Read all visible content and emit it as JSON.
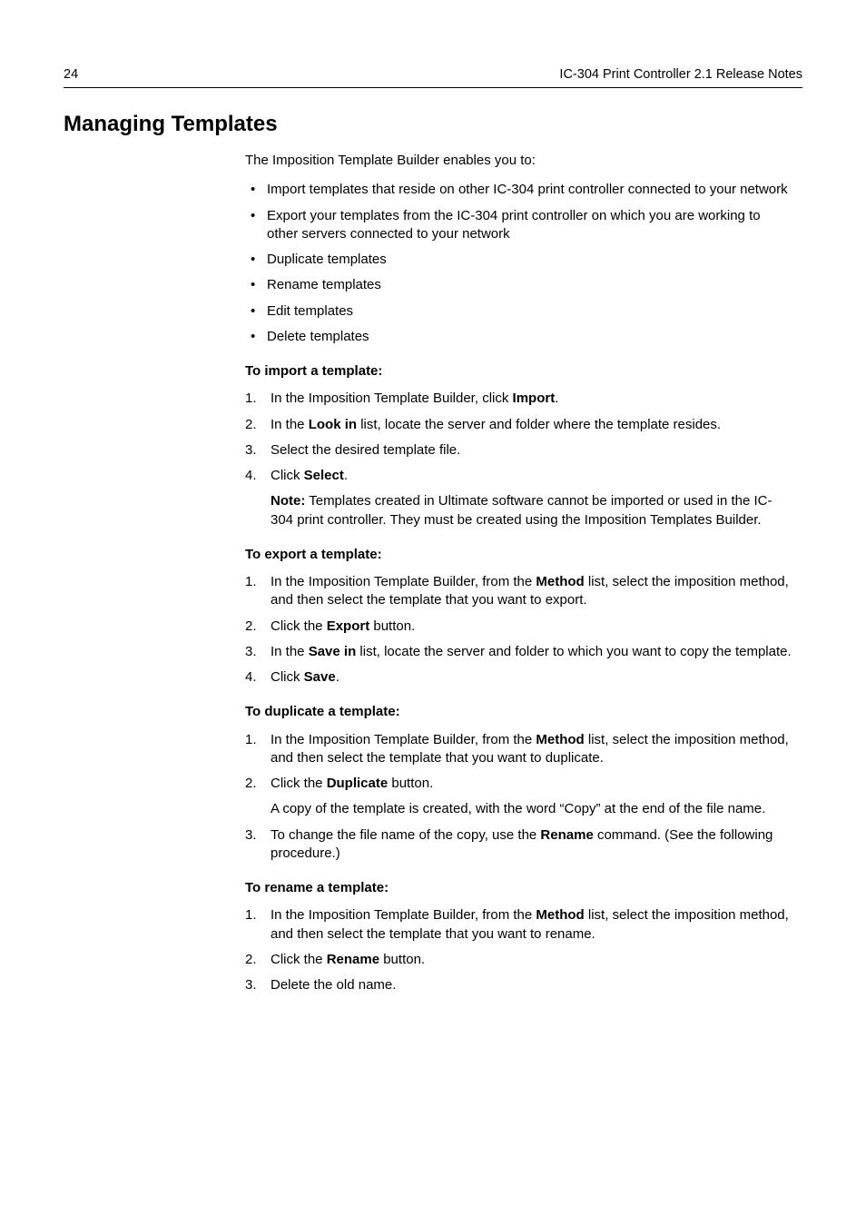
{
  "header": {
    "page_number": "24",
    "doc_title": "IC-304 Print Controller 2.1 Release Notes"
  },
  "section_title": "Managing Templates",
  "intro": "The Imposition Template Builder enables you to:",
  "bullets": [
    "Import templates that reside on other IC-304 print controller connected to your network",
    "Export your templates from the IC-304 print controller on which you are working to other servers connected to your network",
    "Duplicate templates",
    "Rename templates",
    "Edit templates",
    "Delete templates"
  ],
  "import": {
    "heading": "To import a template:",
    "step1_pre": "In the Imposition Template Builder, click ",
    "step1_b": "Import",
    "step1_post": ".",
    "step2_pre": "In the ",
    "step2_b": "Look in",
    "step2_post": " list, locate the server and folder where the template resides.",
    "step3": "Select the desired template file.",
    "step4_pre": "Click ",
    "step4_b": "Select",
    "step4_post": ".",
    "note_label": "Note:",
    "note_body": "  Templates created in Ultimate software cannot be imported or used in the IC-304 print controller. They must be created using the Imposition Templates Builder."
  },
  "export": {
    "heading": "To export a template:",
    "step1_pre": "In the Imposition Template Builder, from the ",
    "step1_b": "Method",
    "step1_post": " list, select the imposition method, and then select the template that you want to export.",
    "step2_pre": "Click the ",
    "step2_b": "Export",
    "step2_post": " button.",
    "step3_pre": "In the ",
    "step3_b": "Save in",
    "step3_post": " list, locate the server and folder to which you want to copy the template.",
    "step4_pre": "Click ",
    "step4_b": "Save",
    "step4_post": "."
  },
  "duplicate": {
    "heading": "To duplicate a template:",
    "step1_pre": "In the Imposition Template Builder, from the ",
    "step1_b": "Method",
    "step1_post": " list, select the imposition method, and then select the template that you want to duplicate.",
    "step2_pre": "Click the ",
    "step2_b": "Duplicate",
    "step2_post": " button.",
    "step2_after": "A copy of the template is created, with the word “Copy” at the end of the file name.",
    "step3_pre": "To change the file name of the copy, use the ",
    "step3_b": "Rename",
    "step3_post": " command. (See the following procedure.)"
  },
  "rename": {
    "heading": "To rename a template:",
    "step1_pre": "In the Imposition Template Builder, from the ",
    "step1_b": "Method",
    "step1_post": " list, select the imposition method, and then select the template that you want to rename.",
    "step2_pre": "Click the ",
    "step2_b": "Rename",
    "step2_post": " button.",
    "step3": "Delete the old name."
  }
}
